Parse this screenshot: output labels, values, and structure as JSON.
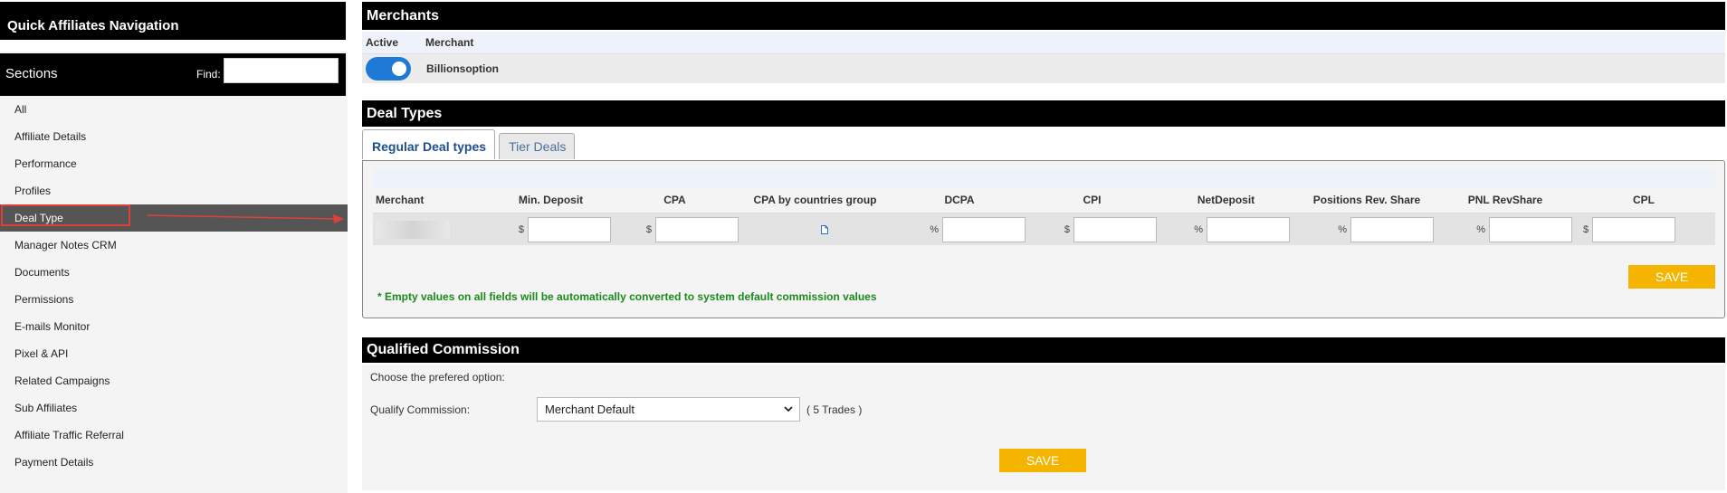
{
  "sidebar": {
    "header": "Quick Affiliates Navigation",
    "sections_title": "Sections",
    "find_label": "Find:",
    "find_value": "",
    "items": [
      {
        "label": "All"
      },
      {
        "label": "Affiliate Details"
      },
      {
        "label": "Performance"
      },
      {
        "label": "Profiles"
      },
      {
        "label": "Deal Type",
        "active": true
      },
      {
        "label": "Manager Notes CRM"
      },
      {
        "label": "Documents"
      },
      {
        "label": "Permissions"
      },
      {
        "label": "E-mails Monitor"
      },
      {
        "label": "Pixel & API"
      },
      {
        "label": "Related Campaigns"
      },
      {
        "label": "Sub Affiliates"
      },
      {
        "label": "Affiliate Traffic Referral"
      },
      {
        "label": "Payment Details"
      }
    ]
  },
  "merchants": {
    "title": "Merchants",
    "col_active": "Active",
    "col_merchant": "Merchant",
    "rows": [
      {
        "active": true,
        "name": "Billionsoption"
      }
    ]
  },
  "deal_types": {
    "title": "Deal Types",
    "tabs": [
      "Regular Deal types",
      "Tier Deals"
    ],
    "columns": [
      "Merchant",
      "Min. Deposit",
      "CPA",
      "CPA by countries group",
      "DCPA",
      "CPI",
      "NetDeposit",
      "Positions Rev. Share",
      "PNL RevShare",
      "CPL"
    ],
    "row_units": {
      "min_deposit": "$",
      "cpa": "$",
      "dcpa": "%",
      "cpi": "$",
      "net_deposit": "%",
      "positions_rev_share": "%",
      "pnl_revshare": "%",
      "cpl": "$"
    },
    "save_label": "SAVE",
    "note": "* Empty values on all fields will be automatically converted to system default commission values"
  },
  "qualified_commission": {
    "title": "Qualified Commission",
    "choose_text": "Choose the prefered option:",
    "qualify_label": "Qualify Commission:",
    "selected": "Merchant Default",
    "trades_text": "( 5 Trades )",
    "save_label": "SAVE"
  },
  "colors": {
    "header_bg": "#000000",
    "toggle_on": "#1e7ad6",
    "save_button": "#f5b400",
    "note_text": "#1a8a1a",
    "active_nav_bg": "#555555",
    "highlight_border": "#e0403a"
  }
}
